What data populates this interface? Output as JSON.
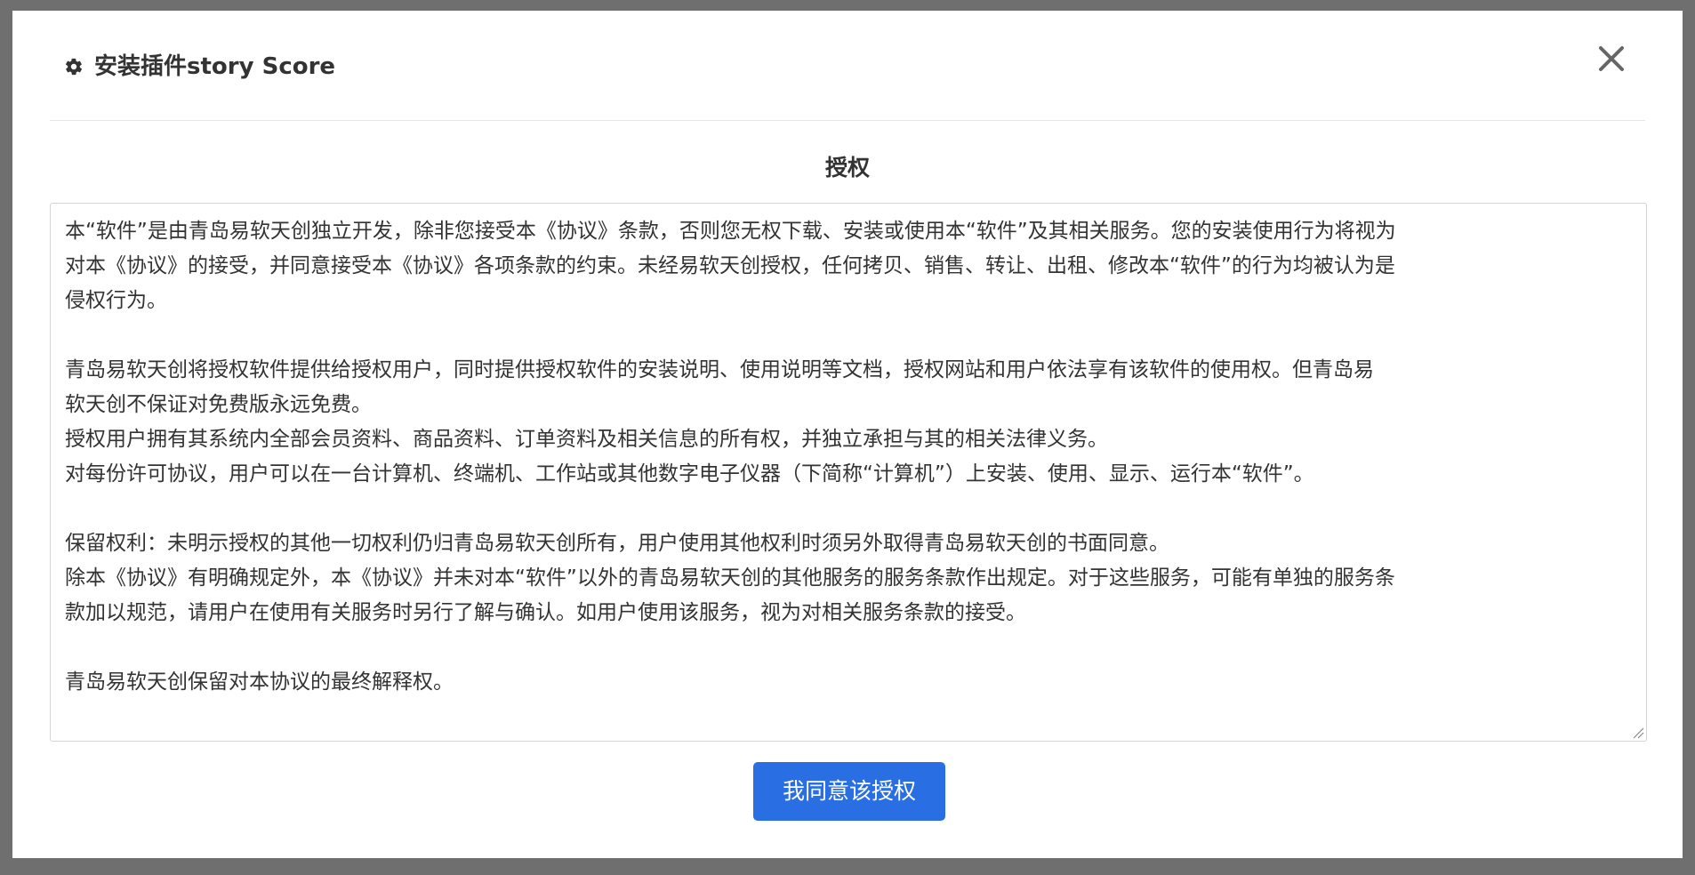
{
  "dialog": {
    "title": "安装插件story Score",
    "header_icon": "gear-icon",
    "close_icon": "close-icon"
  },
  "section": {
    "title": "授权"
  },
  "agreement": {
    "lines": [
      "本“软件”是由青岛易软天创独立开发，除非您接受本《协议》条款，否则您无权下载、安装或使用本“软件”及其相关服务。您的安装使用行为将视为",
      "对本《协议》的接受，并同意接受本《协议》各项条款的约束。未经易软天创授权，任何拷贝、销售、转让、出租、修改本“软件”的行为均被认为是",
      "侵权行为。",
      "",
      "青岛易软天创将授权软件提供给授权用户，同时提供授权软件的安装说明、使用说明等文档，授权网站和用户依法享有该软件的使用权。但青岛易",
      "软天创不保证对免费版永远免费。",
      "授权用户拥有其系统内全部会员资料、商品资料、订单资料及相关信息的所有权，并独立承担与其的相关法律义务。",
      "对每份许可协议，用户可以在一台计算机、终端机、工作站或其他数字电子仪器（下简称“计算机”）上安装、使用、显示、运行本“软件”。",
      "",
      "保留权利：未明示授权的其他一切权利仍归青岛易软天创所有，用户使用其他权利时须另外取得青岛易软天创的书面同意。",
      "除本《协议》有明确规定外，本《协议》并未对本“软件”以外的青岛易软天创的其他服务的服务条款作出规定。对于这些服务，可能有单独的服务条",
      "款加以规范，请用户在使用有关服务时另行了解与确认。如用户使用该服务，视为对相关服务条款的接受。",
      "",
      "青岛易软天创保留对本协议的最终解释权。"
    ]
  },
  "actions": {
    "agree_label": "我同意该授权"
  },
  "colors": {
    "primary": "#2a6ee4",
    "backdrop": "#6f6f6f"
  }
}
